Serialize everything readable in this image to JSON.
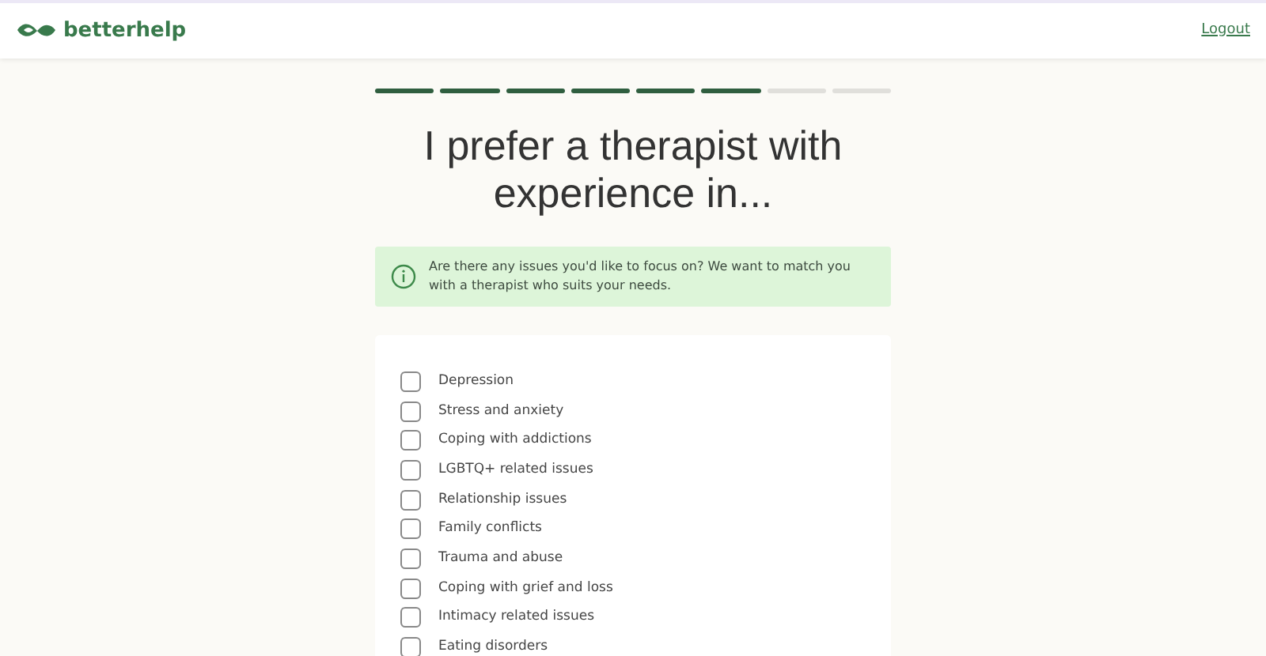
{
  "header": {
    "brand": "betterhelp",
    "logout": "Logout"
  },
  "progress": [
    {
      "complete": true
    },
    {
      "complete": true
    },
    {
      "complete": true
    },
    {
      "complete": true
    },
    {
      "complete": true
    },
    {
      "complete": true
    },
    {
      "complete": false
    },
    {
      "complete": false
    }
  ],
  "title": "I prefer a therapist with experience in...",
  "info": "Are there any issues you'd like to focus on? We want to match you with a therapist who suits your needs.",
  "options": [
    {
      "label": "Depression",
      "checked": false
    },
    {
      "label": "Stress and anxiety",
      "checked": false
    },
    {
      "label": "Coping with addictions",
      "checked": false
    },
    {
      "label": "LGBTQ+ related issues",
      "checked": false
    },
    {
      "label": "Relationship issues",
      "checked": false
    },
    {
      "label": "Family conflicts",
      "checked": false
    },
    {
      "label": "Trauma and abuse",
      "checked": false
    },
    {
      "label": "Coping with grief and loss",
      "checked": false
    },
    {
      "label": "Intimacy related issues",
      "checked": false
    },
    {
      "label": "Eating disorders",
      "checked": false
    }
  ]
}
